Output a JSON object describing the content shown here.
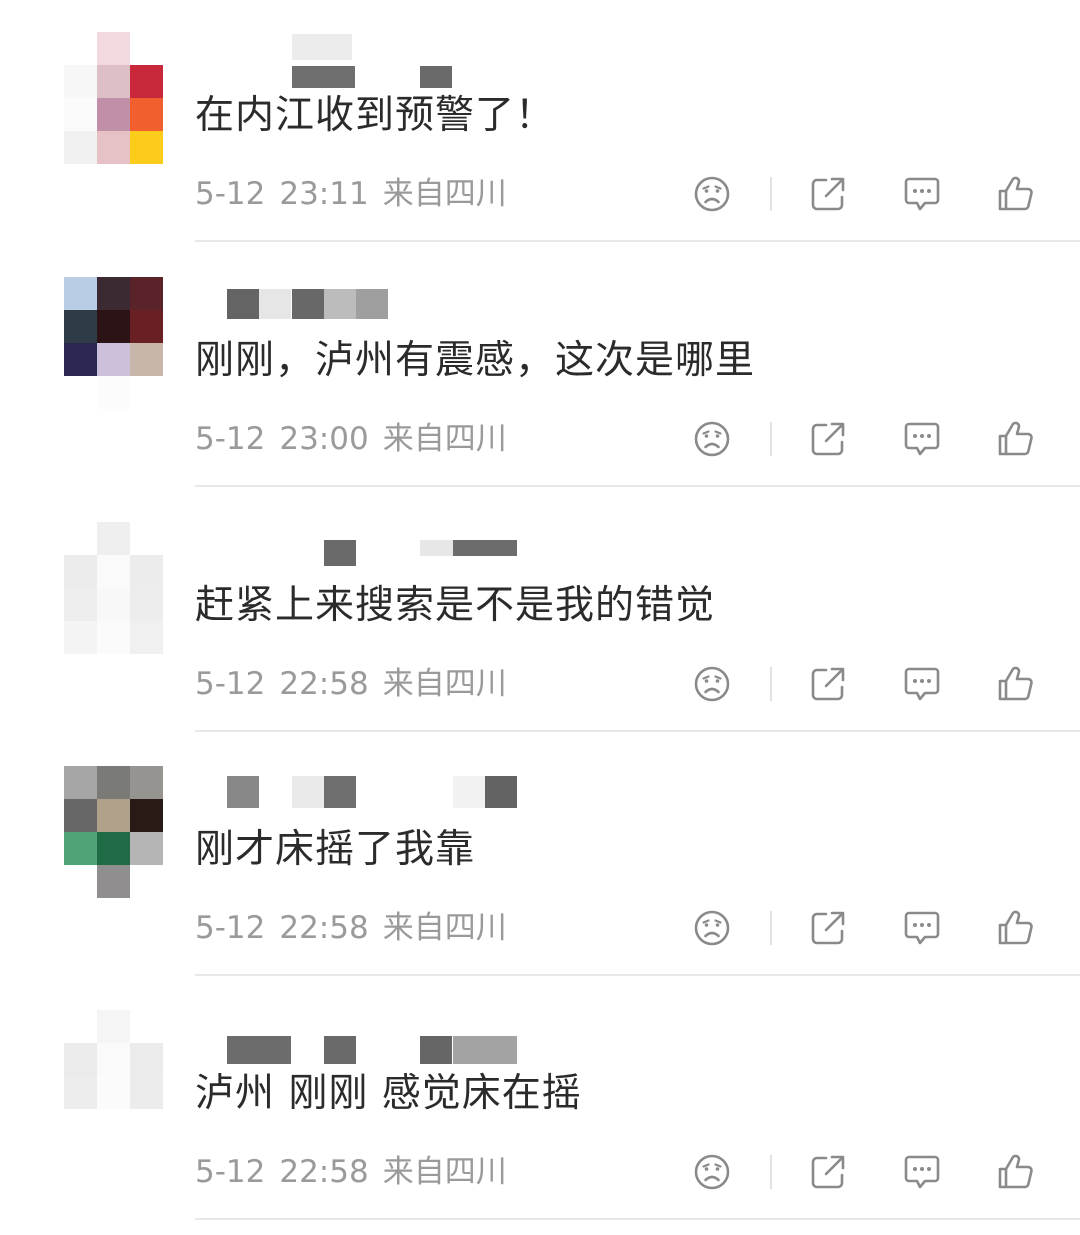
{
  "comments": [
    {
      "content": "在内江收到预警了！",
      "date": "5-12",
      "time": "23:11",
      "location": "来自四川",
      "avatar": [
        [
          "#ffffff",
          "#f1d9de",
          "#ffffff"
        ],
        [
          "#f7f7f7",
          "#dcc0c6",
          "#c8283a"
        ],
        [
          "#fbfbfb",
          "#c28fa8",
          "#f15f2e"
        ],
        [
          "#f1f1f1",
          "#e6c2c6",
          "#fbcc19"
        ]
      ],
      "name_blocks": [
        {
          "color": "#ececec"
        },
        {
          "color": "#6e6e6e"
        },
        {
          "color": "#6a6a6a"
        }
      ]
    },
    {
      "content": "刚刚，泸州有震感，这次是哪里",
      "date": "5-12",
      "time": "23:00",
      "location": "来自四川",
      "avatar": [
        [
          "#b9cde4",
          "#3b2a32",
          "#5a2329"
        ],
        [
          "#2f3b46",
          "#2c1316",
          "#6a1f24"
        ],
        [
          "#2a2850",
          "#ccc0da",
          "#c9b6aa"
        ],
        [
          "#ffffff",
          "#fcfcfc",
          "#ffffff"
        ]
      ],
      "name_blocks": [
        {
          "color": "#646464"
        },
        {
          "color": "#e6e6e6"
        },
        {
          "color": "#686868"
        },
        {
          "color": "#bcbcbc"
        },
        {
          "color": "#9f9f9f"
        }
      ]
    },
    {
      "content": "赶紧上来搜索是不是我的错觉",
      "date": "5-12",
      "time": "22:58",
      "location": "来自四川",
      "avatar": [
        [
          "#ffffff",
          "#efefef",
          "#ffffff"
        ],
        [
          "#ececec",
          "#fafafa",
          "#ececec"
        ],
        [
          "#eeeeee",
          "#f8f8f8",
          "#ededed"
        ],
        [
          "#f4f4f4",
          "#fbfbfb",
          "#f0f0f0"
        ]
      ],
      "name_blocks": [
        {
          "color": "#6a6a6a"
        },
        {
          "color": "#e7e7e7"
        },
        {
          "color": "#6c6c6c"
        }
      ]
    },
    {
      "content": "刚才床摇了我靠",
      "date": "5-12",
      "time": "22:58",
      "location": "来自四川",
      "avatar": [
        [
          "#a7a6a6",
          "#7a7a76",
          "#969491"
        ],
        [
          "#676767",
          "#b1a08a",
          "#2a1a16"
        ],
        [
          "#4ea377",
          "#1f6b45",
          "#b5b5b5"
        ],
        [
          "#ffffff",
          "#908e8e",
          "#ffffff"
        ]
      ],
      "name_blocks": [
        {
          "color": "#878787"
        },
        {
          "color": "#eaeaea"
        },
        {
          "color": "#6e6e6e"
        },
        {
          "color": "#f2f2f2"
        },
        {
          "color": "#636363"
        }
      ]
    },
    {
      "content": "泸州 刚刚 感觉床在摇",
      "date": "5-12",
      "time": "22:58",
      "location": "来自四川",
      "avatar": [
        [
          "#ffffff",
          "#f5f5f5",
          "#ffffff"
        ],
        [
          "#ebebeb",
          "#fafafa",
          "#ebebeb"
        ],
        [
          "#ededed",
          "#fbfbfb",
          "#ececec"
        ],
        [
          "#ffffff",
          "#ffffff",
          "#ffffff"
        ]
      ],
      "name_blocks": [
        {
          "color": "#6c6c6c"
        },
        {
          "color": "#6a6a6a"
        },
        {
          "color": "#666666"
        },
        {
          "color": "#a3a3a3"
        }
      ]
    }
  ],
  "icons": {
    "dislike": "dislike-face-icon",
    "share": "share-icon",
    "reply": "comment-icon",
    "like": "thumbs-up-icon"
  },
  "colors": {
    "text": "#2b2b2b",
    "meta": "#9a9a9a",
    "icon": "#8a8a8a",
    "divider": "#e8e8e8"
  }
}
